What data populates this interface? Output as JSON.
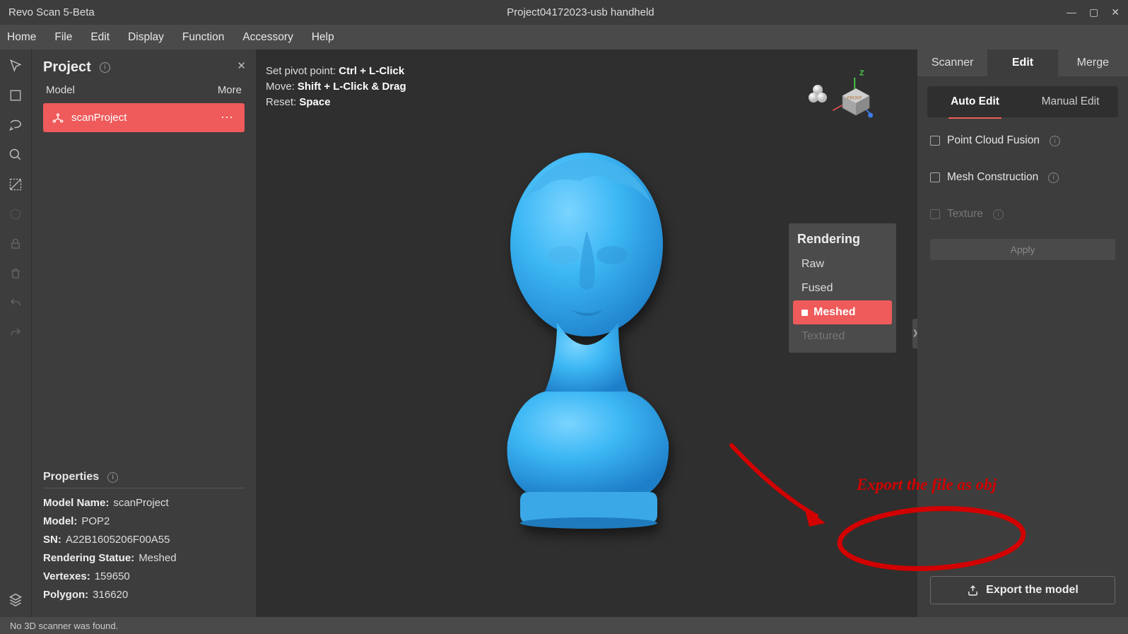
{
  "titlebar": {
    "app": "Revo Scan 5-Beta",
    "project": "Project04172023-usb handheld"
  },
  "menubar": {
    "items": [
      "Home",
      "File",
      "Edit",
      "Display",
      "Function",
      "Accessory",
      "Help"
    ]
  },
  "project_panel": {
    "title": "Project",
    "model_label": "Model",
    "more_label": "More",
    "items": [
      {
        "name": "scanProject"
      }
    ],
    "properties_title": "Properties",
    "props": {
      "model_name_k": "Model Name:",
      "model_name_v": "scanProject",
      "model_k": "Model:",
      "model_v": "POP2",
      "sn_k": "SN:",
      "sn_v": "A22B1605206F00A55",
      "rstatus_k": "Rendering Statue:",
      "rstatus_v": "Meshed",
      "vert_k": "Vertexes:",
      "vert_v": "159650",
      "poly_k": "Polygon:",
      "poly_v": "316620"
    }
  },
  "viewport_hints": {
    "l1k": "Set pivot point:",
    "l1v": "Ctrl +  L-Click",
    "l2k": "Move:",
    "l2v": "Shift + L-Click & Drag",
    "l3k": "Reset:",
    "l3v": "Space"
  },
  "rendering": {
    "title": "Rendering",
    "options": {
      "raw": "Raw",
      "fused": "Fused",
      "meshed": "Meshed",
      "textured": "Textured"
    }
  },
  "right": {
    "tabs1": {
      "scanner": "Scanner",
      "edit": "Edit",
      "merge": "Merge"
    },
    "tabs2": {
      "auto": "Auto Edit",
      "manual": "Manual Edit"
    },
    "opts": {
      "pcf": "Point Cloud Fusion",
      "mesh": "Mesh Construction",
      "tex": "Texture"
    },
    "apply": "Apply",
    "export": "Export the model"
  },
  "statusbar": {
    "msg": "No 3D scanner was found."
  },
  "annotation": {
    "text": "Export the file as obj"
  }
}
